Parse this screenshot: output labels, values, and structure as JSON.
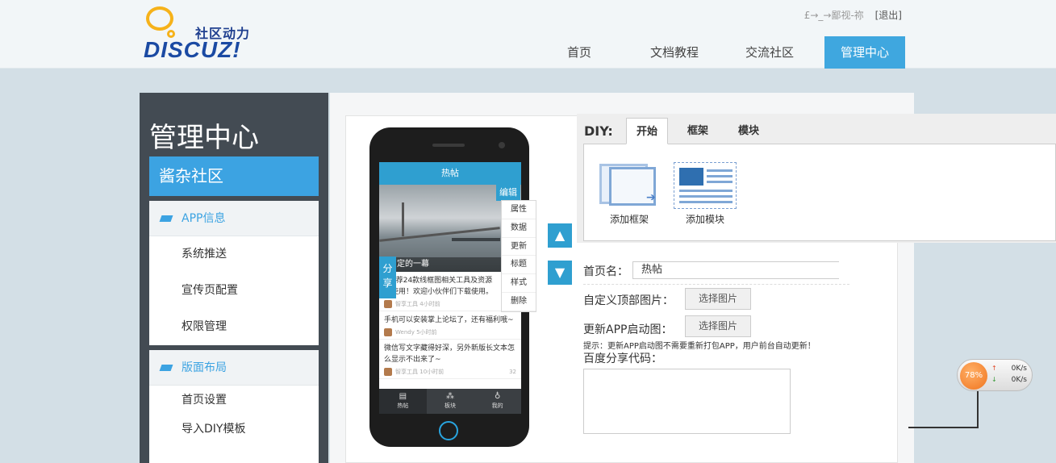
{
  "header": {
    "logo_cn": "社区动力",
    "logo_en": "DISCUZ!",
    "user_text": "£→_→鄙视-祢",
    "logout": "[退出]",
    "nav": [
      {
        "label": "首页"
      },
      {
        "label": "文档教程"
      },
      {
        "label": "交流社区"
      },
      {
        "label": "管理中心",
        "active": true
      }
    ]
  },
  "sidebar": {
    "title": "管理中心",
    "site_name": "酱杂社区",
    "groups": [
      {
        "label": "APP信息",
        "items": [
          "系统推送",
          "宣传页配置",
          "权限管理"
        ]
      },
      {
        "label": "版面布局",
        "items": [
          "首页设置",
          "导入DIY模板"
        ]
      }
    ]
  },
  "phone": {
    "screen_title": "热帖",
    "photo_caption": "定的一幕",
    "share_tag": "分享",
    "edit_tag": "编辑",
    "context_menu": [
      "属性",
      "数据",
      "更新",
      "标题",
      "样式",
      "删除"
    ],
    "posts": [
      {
        "text": "6推荐24款线框图相关工具及资源\n费使用！欢迎小伙伴们下载使用。",
        "author": "智享工具",
        "time": "4小时前",
        "count": ""
      },
      {
        "text": "手机可以安装掌上论坛了，还有福利哦~",
        "author": "Wendy",
        "time": "5小时前",
        "count": ""
      },
      {
        "text": "微信写文字藏得好深，另外新版长文本怎\n么显示不出来了~",
        "author": "智享工具",
        "time": "10小时前",
        "count": "32"
      }
    ],
    "tabs": [
      {
        "icon": "▤",
        "label": "热帖",
        "active": true
      },
      {
        "icon": "⁂",
        "label": "板块"
      },
      {
        "icon": "♁",
        "label": "我的"
      }
    ],
    "up_arrow": "▲",
    "down_arrow": "▼"
  },
  "diy": {
    "label": "DIY:",
    "tabs": [
      {
        "label": "开始",
        "active": true
      },
      {
        "label": "框架"
      },
      {
        "label": "模块"
      }
    ],
    "tools": [
      {
        "label": "添加框架",
        "icon": "frame-icon"
      },
      {
        "label": "添加模块",
        "icon": "module-icon"
      }
    ]
  },
  "form": {
    "home_name_label": "首页名：",
    "home_name_value": "热帖",
    "top_image_label": "自定义顶部图片：",
    "top_image_button": "选择图片",
    "launch_image_label": "更新APP启动图：",
    "launch_image_button": "选择图片",
    "hint": "提示：更新APP启动图不需要重新打包APP，用户前台自动更新！",
    "baidu_share_label": "百度分享代码："
  },
  "speed_widget": {
    "percent": "78%",
    "up": "0K/s",
    "down": "0K/s"
  }
}
